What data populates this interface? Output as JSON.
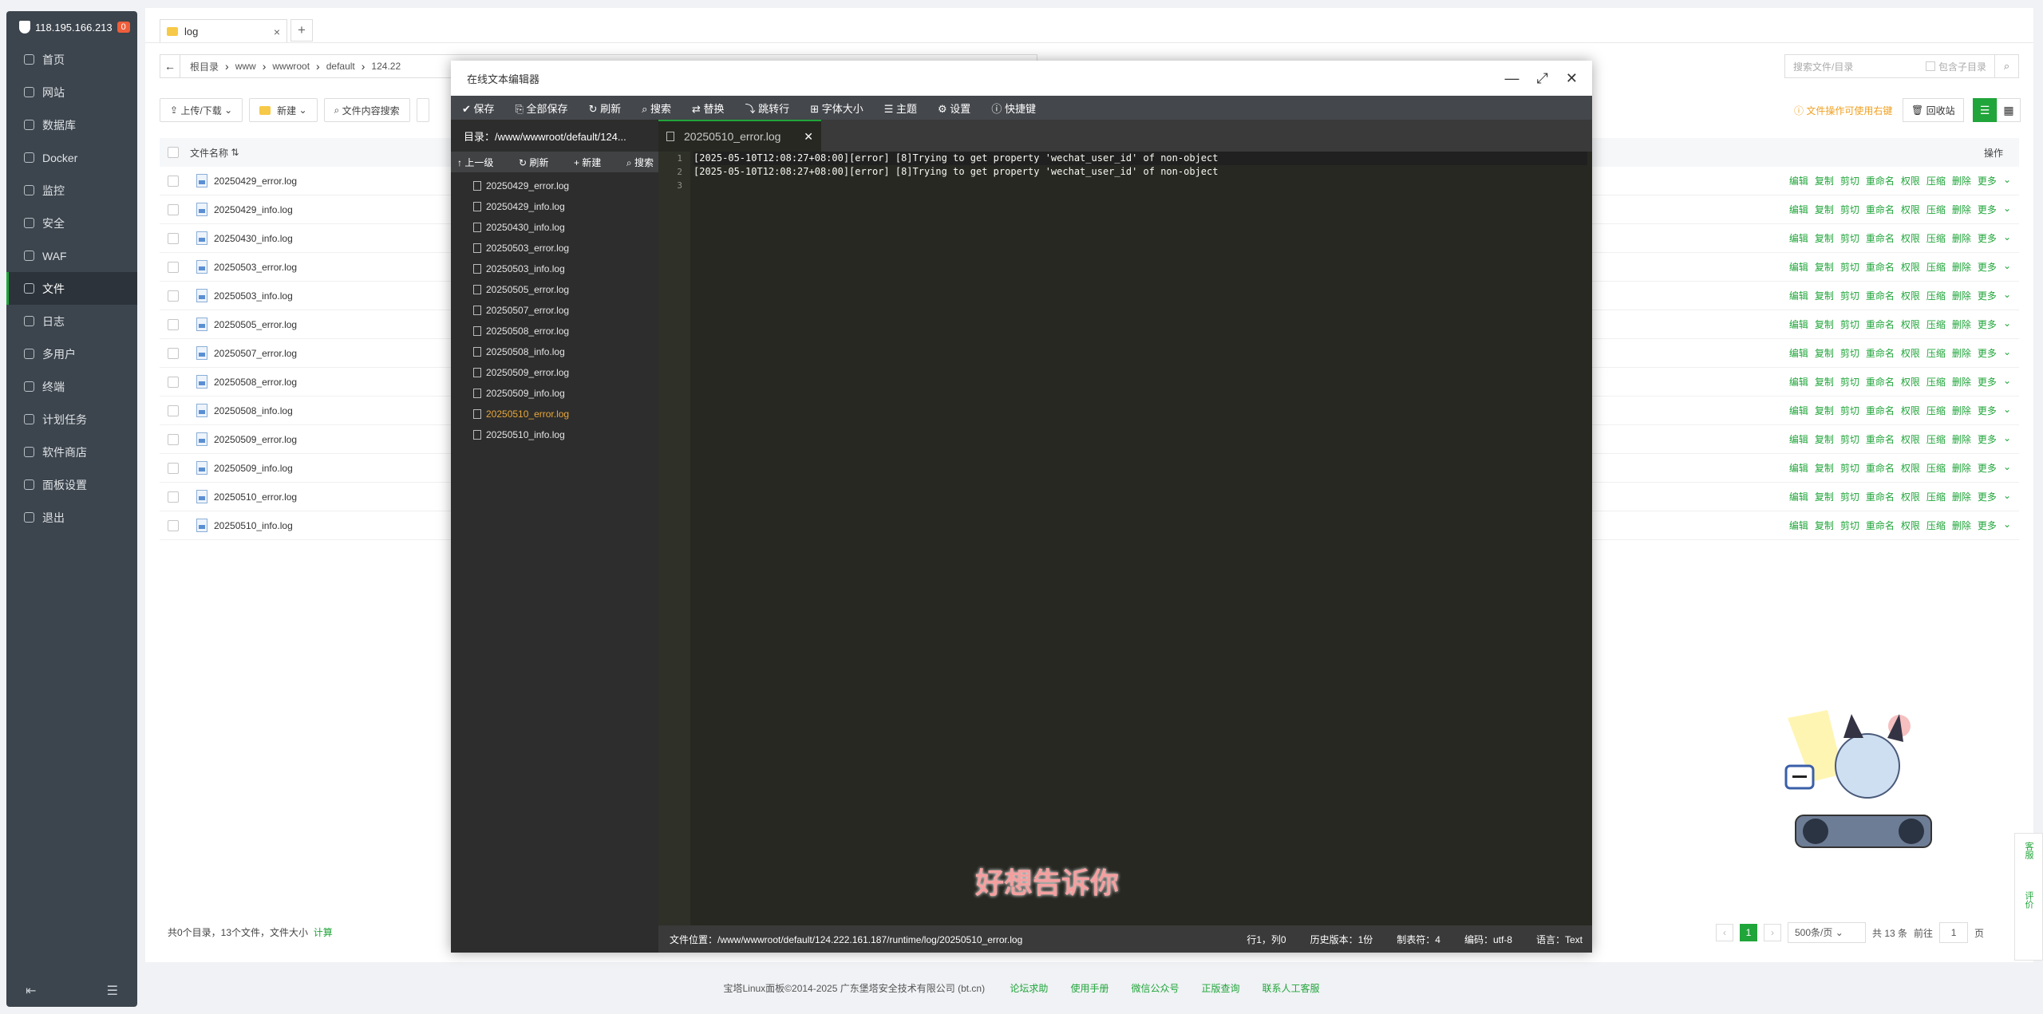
{
  "sidebar": {
    "ip": "118.195.166.213",
    "badge": "0",
    "items": [
      {
        "label": "首页"
      },
      {
        "label": "网站"
      },
      {
        "label": "数据库"
      },
      {
        "label": "Docker"
      },
      {
        "label": "监控"
      },
      {
        "label": "安全"
      },
      {
        "label": "WAF"
      },
      {
        "label": "文件"
      },
      {
        "label": "日志"
      },
      {
        "label": "多用户"
      },
      {
        "label": "终端"
      },
      {
        "label": "计划任务"
      },
      {
        "label": "软件商店"
      },
      {
        "label": "面板设置"
      },
      {
        "label": "退出"
      }
    ]
  },
  "tab": {
    "label": "log",
    "close": "×",
    "add": "+"
  },
  "breadcrumb": [
    "根目录",
    "www",
    "wwwroot",
    "default",
    "124.22"
  ],
  "search": {
    "placeholder": "搜索文件/目录",
    "include_sub": "包含子目录"
  },
  "toolbar": {
    "upload": "上传/下载",
    "new": "新建",
    "content_search": "文件内容搜索"
  },
  "tips": "文件操作可使用右键",
  "recycle": "回收站",
  "table": {
    "col_name": "文件名称",
    "col_ops": "操作",
    "ops": [
      "编辑",
      "复制",
      "剪切",
      "重命名",
      "权限",
      "压缩",
      "删除",
      "更多"
    ],
    "files": [
      "20250429_error.log",
      "20250429_info.log",
      "20250430_info.log",
      "20250503_error.log",
      "20250503_info.log",
      "20250505_error.log",
      "20250507_error.log",
      "20250508_error.log",
      "20250508_info.log",
      "20250509_error.log",
      "20250509_info.log",
      "20250510_error.log",
      "20250510_info.log"
    ]
  },
  "footer_stat": {
    "text": "共0个目录，13个文件，文件大小",
    "calc": "计算"
  },
  "pager": {
    "page": "1",
    "per_page": "500条/页",
    "total": "共 13 条",
    "goto": "前往",
    "goto_val": "1",
    "page_suffix": "页"
  },
  "copyright": {
    "text": "宝塔Linux面板©2014-2025 广东堡塔安全技术有限公司 (bt.cn)",
    "links": [
      "论坛求助",
      "使用手册",
      "微信公众号",
      "正版查询",
      "联系人工客服"
    ]
  },
  "editor": {
    "title": "在线文本编辑器",
    "menu": [
      "保存",
      "全部保存",
      "刷新",
      "搜索",
      "替换",
      "跳转行",
      "字体大小",
      "主题",
      "设置",
      "快捷键"
    ],
    "dir": "目录：/www/wwwroot/default/124...",
    "left_tools": [
      "上一级",
      "刷新",
      "新建",
      "搜索"
    ],
    "files": [
      "20250429_error.log",
      "20250429_info.log",
      "20250430_info.log",
      "20250503_error.log",
      "20250503_info.log",
      "20250505_error.log",
      "20250507_error.log",
      "20250508_error.log",
      "20250508_info.log",
      "20250509_error.log",
      "20250509_info.log",
      "20250510_error.log",
      "20250510_info.log"
    ],
    "active_tab": "20250510_error.log",
    "lines": [
      "[2025-05-10T12:08:27+08:00][error] [8]Trying to get property 'wechat_user_id' of non-object",
      "[2025-05-10T12:08:27+08:00][error] [8]Trying to get property 'wechat_user_id' of non-object",
      ""
    ],
    "status": {
      "path": "文件位置：/www/wwwroot/default/124.222.161.187/runtime/log/20250510_error.log",
      "pos": "行1，列0",
      "history": "历史版本：1份",
      "tab": "制表符：4",
      "encoding": "编码：utf-8",
      "lang": "语言：Text"
    }
  },
  "overlay_caption": "好想告诉你",
  "side_float": [
    "客服",
    "评价"
  ],
  "colors": {
    "accent": "#20a53a",
    "sidebar": "#3c444d",
    "editor_bg": "#272822"
  }
}
